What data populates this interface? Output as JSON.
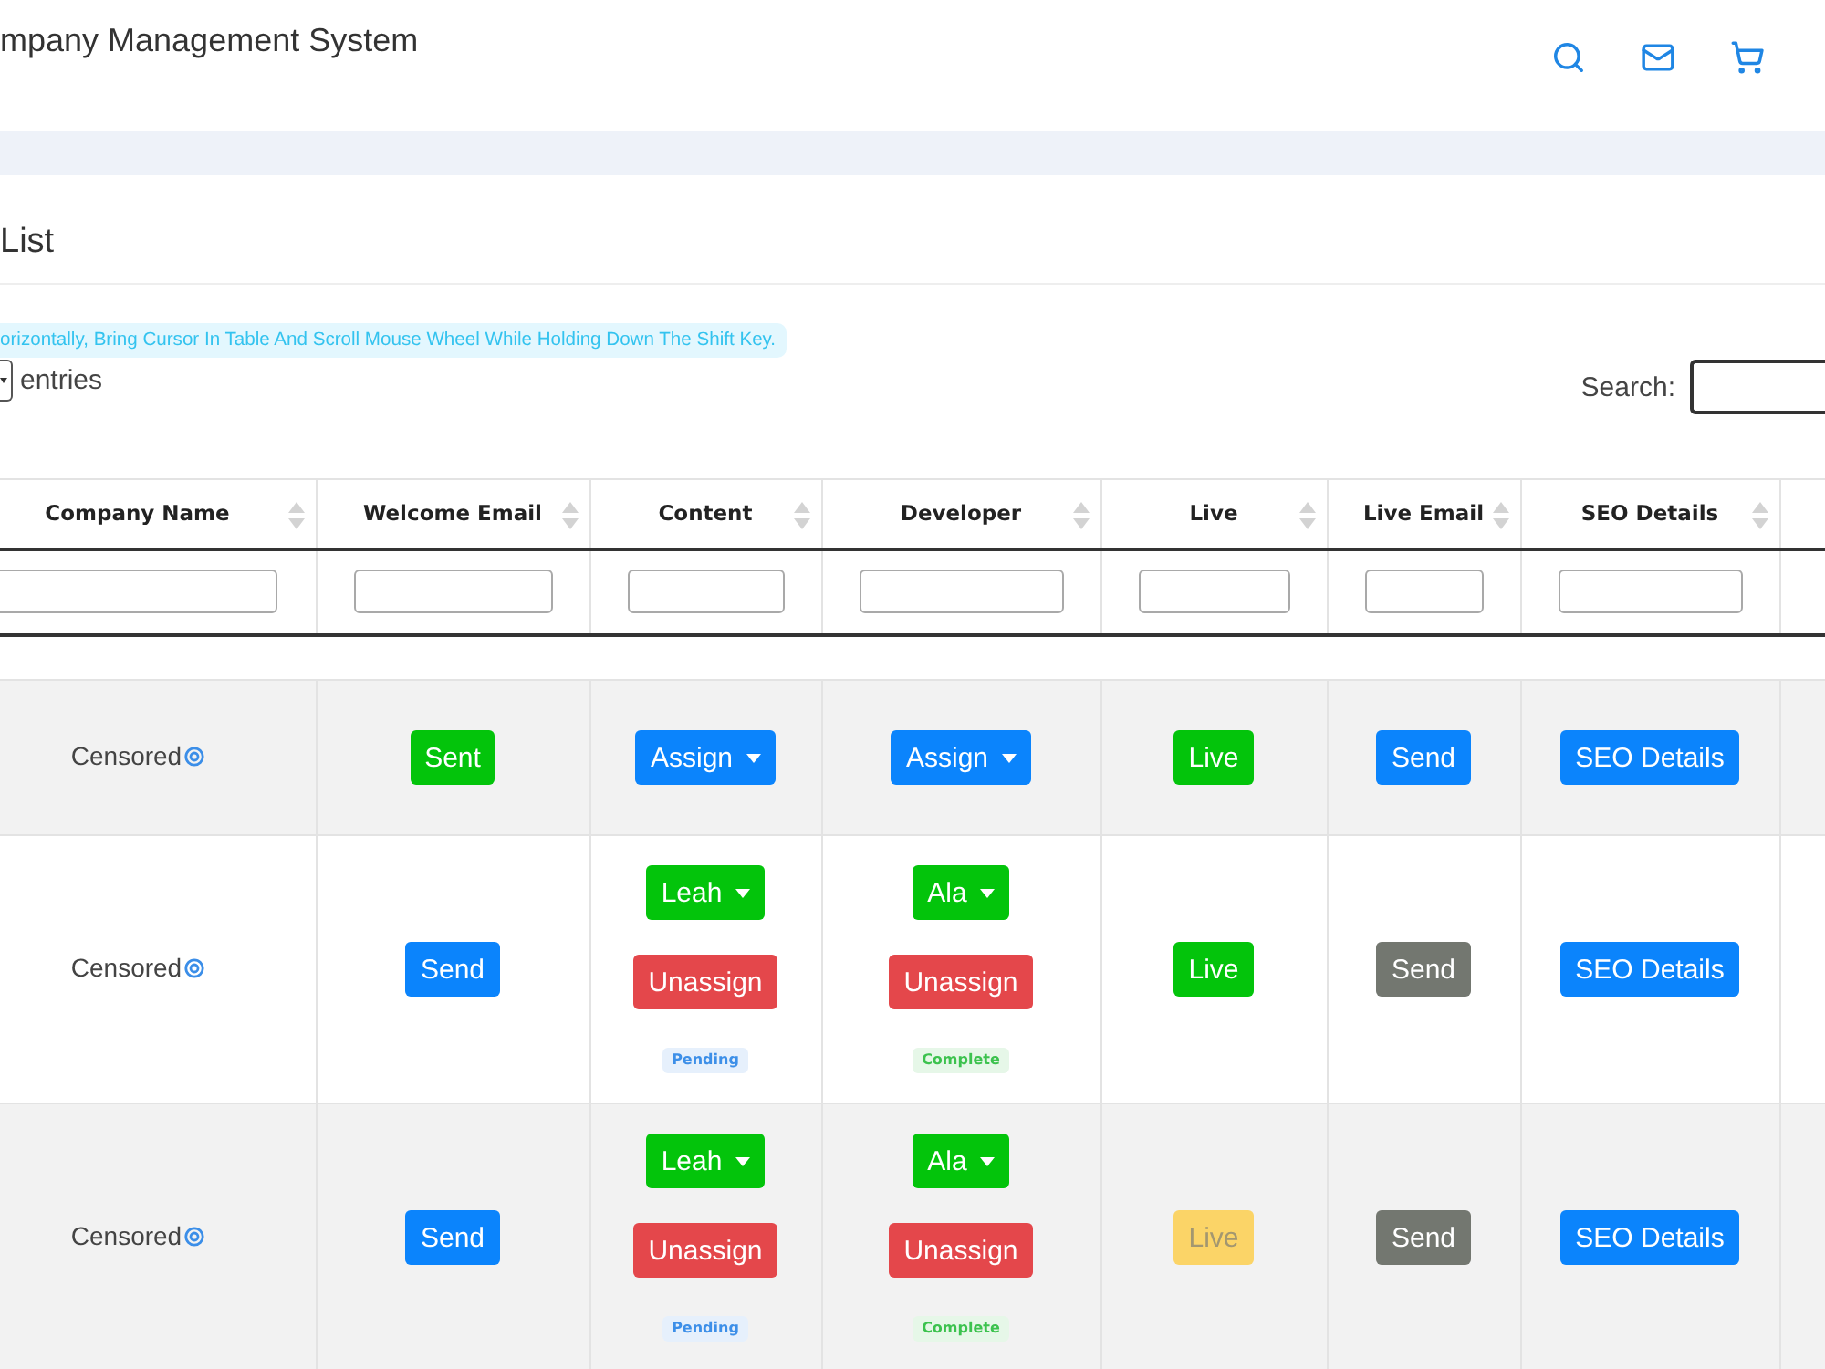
{
  "header": {
    "title": "mpany Management System"
  },
  "card": {
    "title": "List",
    "notice": "orizontally, Bring Cursor In Table And Scroll Mouse Wheel While Holding Down The Shift Key.",
    "length_label": "entries",
    "search_label": "Search:"
  },
  "table": {
    "columns": [
      {
        "label": "Company Name"
      },
      {
        "label": "Welcome Email"
      },
      {
        "label": "Content"
      },
      {
        "label": "Developer"
      },
      {
        "label": "Live"
      },
      {
        "label": "Live Email"
      },
      {
        "label": "SEO Details"
      }
    ],
    "rows": [
      {
        "company_name": "Censored",
        "welcome_email": [
          {
            "kind": "button",
            "label": "Sent",
            "color": "#03c40b"
          }
        ],
        "content": [
          {
            "kind": "dropdown",
            "label": "Assign",
            "color": "#0b84fc"
          }
        ],
        "developer": [
          {
            "kind": "dropdown",
            "label": "Assign",
            "color": "#0b84fc"
          }
        ],
        "live": [
          {
            "kind": "button",
            "label": "Live",
            "color": "#03c40b"
          }
        ],
        "live_email": [
          {
            "kind": "button",
            "label": "Send",
            "color": "#0b84fc"
          }
        ],
        "seo_details": [
          {
            "kind": "button",
            "label": "SEO Details",
            "color": "#0b84fc"
          }
        ]
      },
      {
        "company_name": "Censored",
        "welcome_email": [
          {
            "kind": "button",
            "label": "Send",
            "color": "#0b84fc"
          }
        ],
        "content": [
          {
            "kind": "dropdown",
            "label": "Leah",
            "color": "#03c40b"
          },
          {
            "kind": "button",
            "label": "Unassign",
            "color": "#e4474b"
          },
          {
            "kind": "badge",
            "label": "Pending",
            "color": "#3d8fe8"
          }
        ],
        "developer": [
          {
            "kind": "dropdown",
            "label": "Ala",
            "color": "#03c40b"
          },
          {
            "kind": "button",
            "label": "Unassign",
            "color": "#e4474b"
          },
          {
            "kind": "badge",
            "label": "Complete",
            "color": "#3cc24e"
          }
        ],
        "live": [
          {
            "kind": "button",
            "label": "Live",
            "color": "#03c40b"
          }
        ],
        "live_email": [
          {
            "kind": "button",
            "label": "Send",
            "color": "#737770"
          }
        ],
        "seo_details": [
          {
            "kind": "button",
            "label": "SEO Details",
            "color": "#0b84fc"
          }
        ]
      },
      {
        "company_name": "Censored",
        "welcome_email": [
          {
            "kind": "button",
            "label": "Send",
            "color": "#0b84fc"
          }
        ],
        "content": [
          {
            "kind": "dropdown",
            "label": "Leah",
            "color": "#03c40b"
          },
          {
            "kind": "button",
            "label": "Unassign",
            "color": "#e4474b"
          },
          {
            "kind": "badge",
            "label": "Pending",
            "color": "#3d8fe8"
          }
        ],
        "developer": [
          {
            "kind": "dropdown",
            "label": "Ala",
            "color": "#03c40b"
          },
          {
            "kind": "button",
            "label": "Unassign",
            "color": "#e4474b"
          },
          {
            "kind": "badge",
            "label": "Complete",
            "color": "#3cc24e"
          }
        ],
        "live": [
          {
            "kind": "button",
            "label": "Live",
            "color": "#fbd467"
          }
        ],
        "live_email": [
          {
            "kind": "button",
            "label": "Send",
            "color": "#737770"
          }
        ],
        "seo_details": [
          {
            "kind": "button",
            "label": "SEO Details",
            "color": "#0b84fc"
          }
        ]
      }
    ]
  }
}
